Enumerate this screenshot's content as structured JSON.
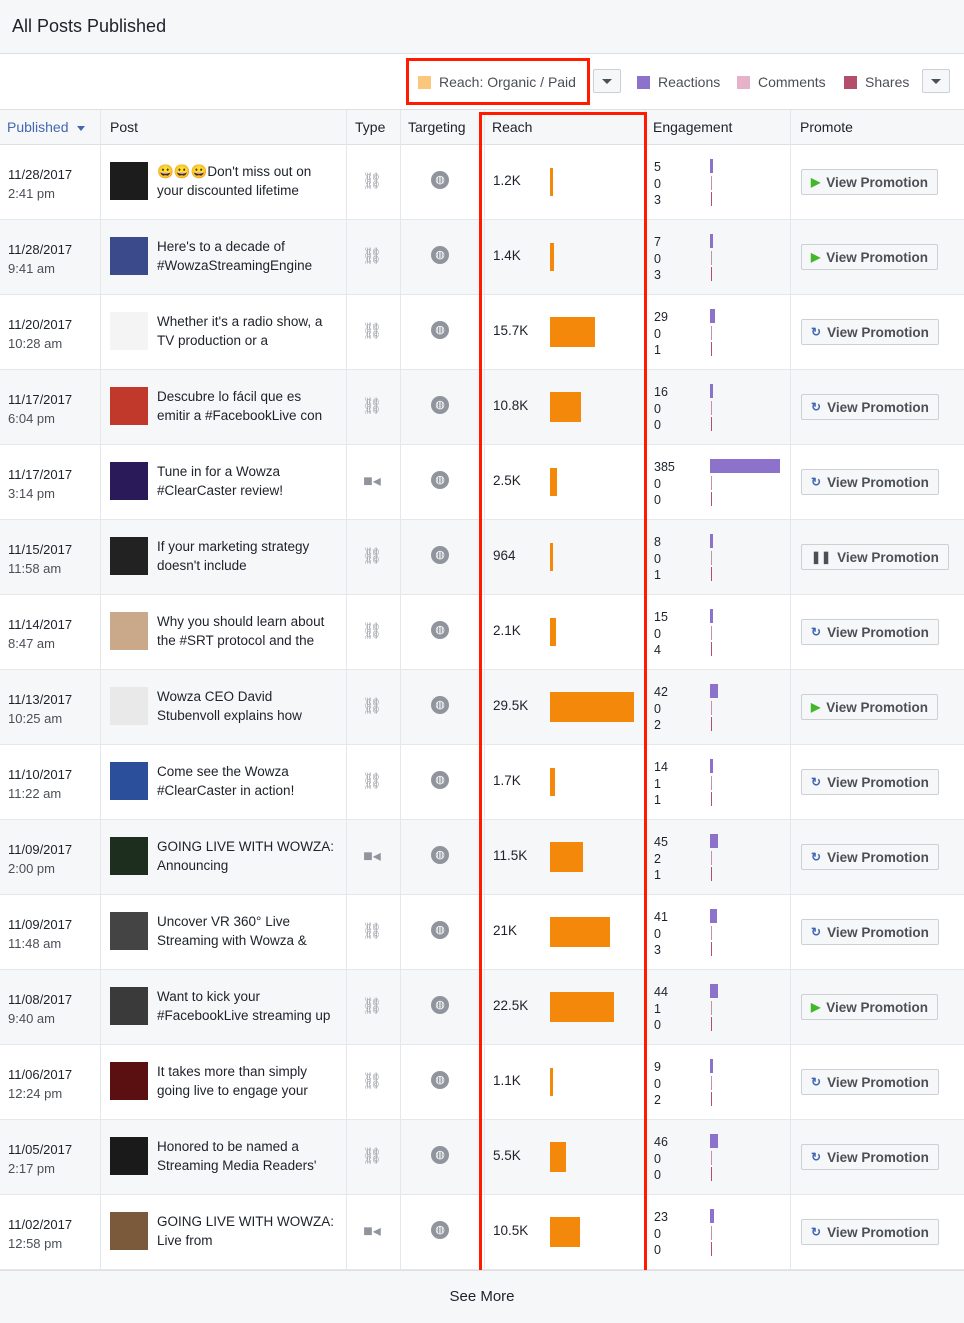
{
  "title": "All Posts Published",
  "legend": {
    "reach": "Reach: Organic / Paid",
    "reactions": "Reactions",
    "comments": "Comments",
    "shares": "Shares",
    "colors": {
      "reach": "#fbc77c",
      "reactions": "#8c72cb",
      "comments": "#e5b2c9",
      "shares": "#b34f6a"
    }
  },
  "columns": {
    "published": "Published",
    "post": "Post",
    "type": "Type",
    "targeting": "Targeting",
    "reach": "Reach",
    "engagement": "Engagement",
    "promote": "Promote"
  },
  "rows": [
    {
      "date": "11/28/2017",
      "time": "2:41 pm",
      "text": "😀😀😀Don't miss out on your discounted lifetime",
      "type": "link",
      "reach": "1.2K",
      "reach_value": 1200,
      "eng": [
        "5",
        "0",
        "3"
      ],
      "promote": "View Promotion",
      "promote_icon": "play",
      "thumb": "#1c1c1c"
    },
    {
      "date": "11/28/2017",
      "time": "9:41 am",
      "text": "Here's to a decade of #WowzaStreamingEngine",
      "type": "link",
      "reach": "1.4K",
      "reach_value": 1400,
      "eng": [
        "7",
        "0",
        "3"
      ],
      "promote": "View Promotion",
      "promote_icon": "play",
      "thumb": "#3a4a8a"
    },
    {
      "date": "11/20/2017",
      "time": "10:28 am",
      "text": "Whether it's a radio show, a TV production or a",
      "type": "link",
      "reach": "15.7K",
      "reach_value": 15700,
      "eng": [
        "29",
        "0",
        "1"
      ],
      "promote": "View Promotion",
      "promote_icon": "refresh",
      "thumb": "#f4f4f4"
    },
    {
      "date": "11/17/2017",
      "time": "6:04 pm",
      "text": "Descubre lo fácil que es emitir a #FacebookLive con",
      "type": "link",
      "reach": "10.8K",
      "reach_value": 10800,
      "eng": [
        "16",
        "0",
        "0"
      ],
      "promote": "View Promotion",
      "promote_icon": "refresh",
      "thumb": "#c0392b"
    },
    {
      "date": "11/17/2017",
      "time": "3:14 pm",
      "text": "Tune in for a Wowza #ClearCaster review!",
      "type": "video",
      "reach": "2.5K",
      "reach_value": 2500,
      "eng": [
        "385",
        "0",
        "0"
      ],
      "promote": "View Promotion",
      "promote_icon": "refresh",
      "thumb": "#2a1a5a"
    },
    {
      "date": "11/15/2017",
      "time": "11:58 am",
      "text": "If your marketing strategy doesn't include",
      "type": "link",
      "reach": "964",
      "reach_value": 964,
      "eng": [
        "8",
        "0",
        "1"
      ],
      "promote": "View Promotion",
      "promote_icon": "pause",
      "thumb": "#222"
    },
    {
      "date": "11/14/2017",
      "time": "8:47 am",
      "text": "Why you should learn about the #SRT protocol and the",
      "type": "link",
      "reach": "2.1K",
      "reach_value": 2100,
      "eng": [
        "15",
        "0",
        "4"
      ],
      "promote": "View Promotion",
      "promote_icon": "refresh",
      "thumb": "#c9a98a"
    },
    {
      "date": "11/13/2017",
      "time": "10:25 am",
      "text": "Wowza CEO David Stubenvoll explains how",
      "type": "link",
      "reach": "29.5K",
      "reach_value": 29500,
      "eng": [
        "42",
        "0",
        "2"
      ],
      "promote": "View Promotion",
      "promote_icon": "play",
      "thumb": "#e9e9e9"
    },
    {
      "date": "11/10/2017",
      "time": "11:22 am",
      "text": "Come see the Wowza #ClearCaster in action!",
      "type": "link",
      "reach": "1.7K",
      "reach_value": 1700,
      "eng": [
        "14",
        "1",
        "1"
      ],
      "promote": "View Promotion",
      "promote_icon": "refresh",
      "thumb": "#2b4f9a"
    },
    {
      "date": "11/09/2017",
      "time": "2:00 pm",
      "text": "GOING LIVE WITH WOWZA: Announcing",
      "type": "video",
      "reach": "11.5K",
      "reach_value": 11500,
      "eng": [
        "45",
        "2",
        "1"
      ],
      "promote": "View Promotion",
      "promote_icon": "refresh",
      "thumb": "#1e2e1e"
    },
    {
      "date": "11/09/2017",
      "time": "11:48 am",
      "text": "Uncover VR 360° Live Streaming with Wowza &",
      "type": "link",
      "reach": "21K",
      "reach_value": 21000,
      "eng": [
        "41",
        "0",
        "3"
      ],
      "promote": "View Promotion",
      "promote_icon": "refresh",
      "thumb": "#444"
    },
    {
      "date": "11/08/2017",
      "time": "9:40 am",
      "text": "Want to kick your #FacebookLive streaming up",
      "type": "link",
      "reach": "22.5K",
      "reach_value": 22500,
      "eng": [
        "44",
        "1",
        "0"
      ],
      "promote": "View Promotion",
      "promote_icon": "play",
      "thumb": "#3a3a3a"
    },
    {
      "date": "11/06/2017",
      "time": "12:24 pm",
      "text": "It takes more than simply going live to engage your",
      "type": "link",
      "reach": "1.1K",
      "reach_value": 1100,
      "eng": [
        "9",
        "0",
        "2"
      ],
      "promote": "View Promotion",
      "promote_icon": "refresh",
      "thumb": "#5a1010"
    },
    {
      "date": "11/05/2017",
      "time": "2:17 pm",
      "text": "Honored to be named a Streaming Media Readers'",
      "type": "link",
      "reach": "5.5K",
      "reach_value": 5500,
      "eng": [
        "46",
        "0",
        "0"
      ],
      "promote": "View Promotion",
      "promote_icon": "refresh",
      "thumb": "#1a1a1a"
    },
    {
      "date": "11/02/2017",
      "time": "12:58 pm",
      "text": "GOING LIVE WITH WOWZA: Live from",
      "type": "video",
      "reach": "10.5K",
      "reach_value": 10500,
      "eng": [
        "23",
        "0",
        "0"
      ],
      "promote": "View Promotion",
      "promote_icon": "refresh",
      "thumb": "#7a5a3a"
    }
  ],
  "footer": {
    "see_more": "See More"
  }
}
